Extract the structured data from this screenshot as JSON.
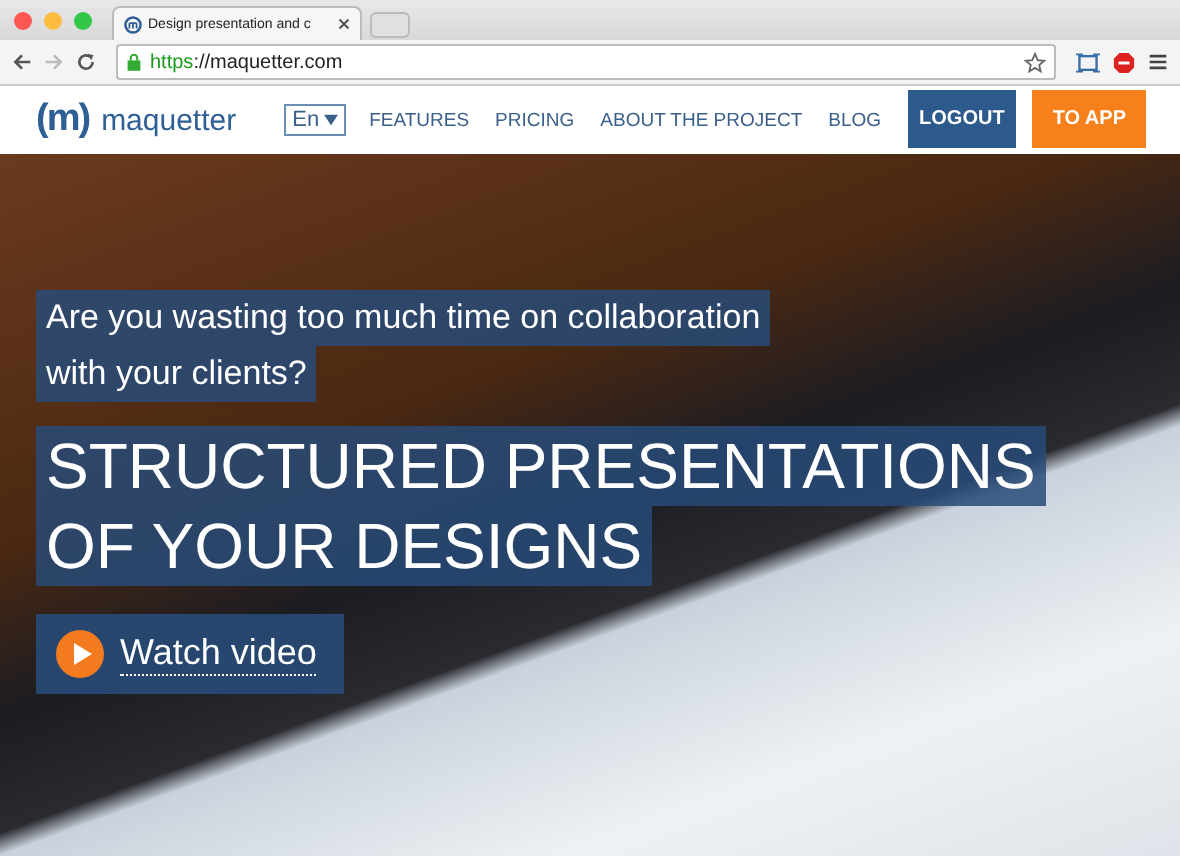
{
  "browser": {
    "tab_title": "Design presentation and c",
    "url_scheme": "https",
    "url_rest": "://maquetter.com"
  },
  "site": {
    "logo_mark": "(m)",
    "logo_text": "maquetter",
    "language": "En",
    "nav": [
      {
        "label": "FEATURES"
      },
      {
        "label": "PRICING"
      },
      {
        "label": "ABOUT THE PROJECT"
      },
      {
        "label": "BLOG"
      }
    ],
    "buttons": [
      {
        "label": "LOGOUT",
        "kind": "secondary"
      },
      {
        "label": "TO APP",
        "kind": "primary"
      }
    ]
  },
  "hero": {
    "question_lines": [
      "Are you wasting too much time on collaboration",
      "with your clients?"
    ],
    "headline_lines": [
      "STRUCTURED PRESENTATIONS",
      "OF YOUR DESIGNS"
    ],
    "video_button": "Watch video"
  }
}
